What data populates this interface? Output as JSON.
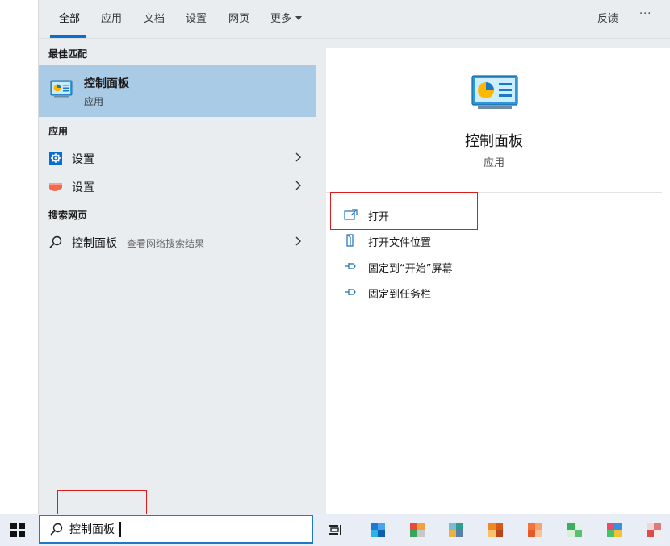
{
  "tabs": {
    "items": [
      {
        "label": "全部"
      },
      {
        "label": "应用"
      },
      {
        "label": "文档"
      },
      {
        "label": "设置"
      },
      {
        "label": "网页"
      },
      {
        "label": "更多"
      }
    ],
    "feedback_label": "反馈",
    "more_dots": "···"
  },
  "results": {
    "best_match_heading": "最佳匹配",
    "best_match": {
      "title": "控制面板",
      "subtitle": "应用"
    },
    "apps_heading": "应用",
    "apps": [
      {
        "label": "设置"
      },
      {
        "label": "设置"
      }
    ],
    "web_heading": "搜索网页",
    "web": {
      "label": "控制面板",
      "suffix": " - 查看网络搜索结果"
    }
  },
  "detail": {
    "title": "控制面板",
    "subtitle": "应用",
    "actions": [
      {
        "label": "打开"
      },
      {
        "label": "打开文件位置"
      },
      {
        "label": "固定到“开始”屏幕"
      },
      {
        "label": "固定到任务栏"
      }
    ]
  },
  "taskbar": {
    "search_value": "控制面板"
  },
  "colors": {
    "accent": "#0a6ed1",
    "selected": "#a9cbe6",
    "annotation": "#e01b1b"
  }
}
